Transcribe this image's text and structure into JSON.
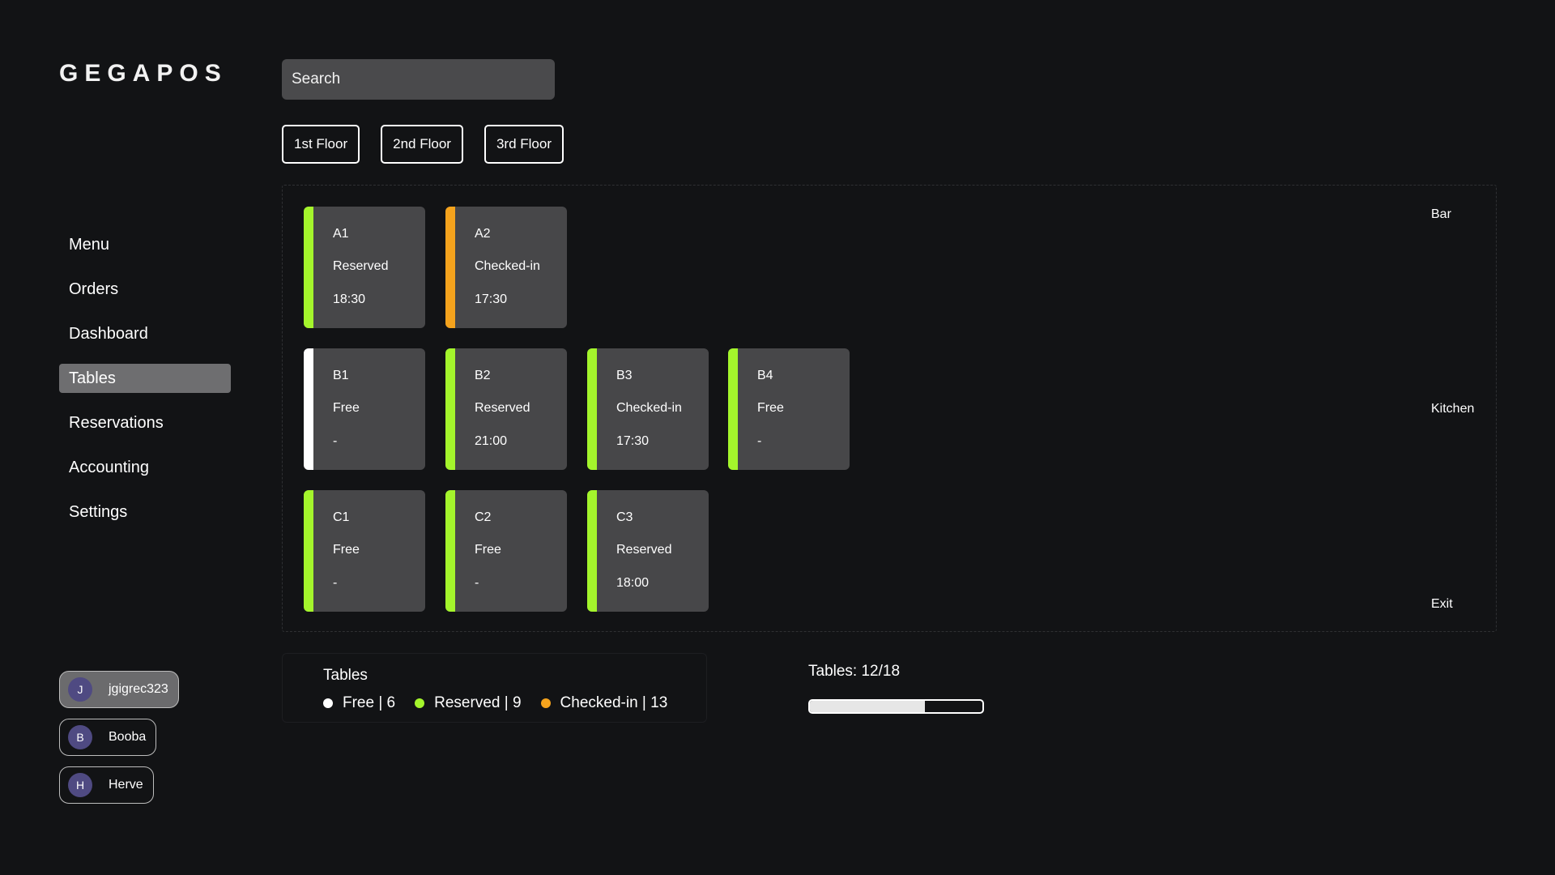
{
  "app": {
    "logo": "GEGAPOS"
  },
  "sidebar": {
    "nav": [
      {
        "label": "Menu"
      },
      {
        "label": "Orders"
      },
      {
        "label": "Dashboard"
      },
      {
        "label": "Tables",
        "active": true
      },
      {
        "label": "Reservations"
      },
      {
        "label": "Accounting"
      },
      {
        "label": "Settings"
      }
    ],
    "users": [
      {
        "initial": "J",
        "name": "jgigrec323",
        "active": true
      },
      {
        "initial": "B",
        "name": "Booba"
      },
      {
        "initial": "H",
        "name": "Herve"
      }
    ]
  },
  "search": {
    "placeholder": "Search"
  },
  "floors": [
    {
      "label": "1st Floor"
    },
    {
      "label": "2nd Floor"
    },
    {
      "label": "3rd Floor"
    }
  ],
  "colors": {
    "free": "#ffffff",
    "reserved": "#a4f52c",
    "checked_in": "#f5a31d",
    "avatar": "#4f4a82"
  },
  "tables": [
    {
      "name": "A1",
      "status": "Reserved",
      "time": "18:30",
      "color": "#a4f52c"
    },
    {
      "name": "A2",
      "status": "Checked-in",
      "time": "17:30",
      "color": "#f5a31d"
    },
    {
      "name": "B1",
      "status": "Free",
      "time": "-",
      "color": "#ffffff"
    },
    {
      "name": "B2",
      "status": "Reserved",
      "time": "21:00",
      "color": "#a4f52c"
    },
    {
      "name": "B3",
      "status": "Checked-in",
      "time": "17:30",
      "color": "#a4f52c"
    },
    {
      "name": "B4",
      "status": "Free",
      "time": "-",
      "color": "#a4f52c"
    },
    {
      "name": "C1",
      "status": "Free",
      "time": "-",
      "color": "#a4f52c"
    },
    {
      "name": "C2",
      "status": "Free",
      "time": "-",
      "color": "#a4f52c"
    },
    {
      "name": "C3",
      "status": "Reserved",
      "time": "18:00",
      "color": "#a4f52c"
    }
  ],
  "areas": {
    "bar": "Bar",
    "kitchen": "Kitchen",
    "exit": "Exit"
  },
  "legend": {
    "title": "Tables",
    "items": [
      {
        "label": "Free | 6",
        "color": "#ffffff"
      },
      {
        "label": "Reserved | 9",
        "color": "#a4f52c"
      },
      {
        "label": "Checked-in | 13",
        "color": "#f5a31d"
      }
    ]
  },
  "stats": {
    "label": "Tables: 12/18",
    "progress_fraction": 0.667
  }
}
